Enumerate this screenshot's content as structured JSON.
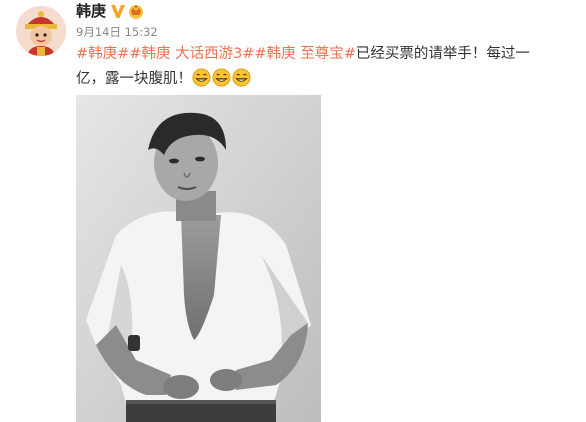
{
  "post": {
    "author": "韩庚",
    "timestamp": "9月14日 15:32",
    "text_segments": [
      {
        "type": "tag",
        "text": "#韩庚#"
      },
      {
        "type": "tag",
        "text": "#韩庚 大话西游3#"
      },
      {
        "type": "tag",
        "text": "#韩庚 至尊宝#"
      },
      {
        "type": "text",
        "text": "已经买票的请举手！每过一亿，露一块腹肌！"
      }
    ],
    "badges": [
      "verified-v-icon",
      "crown-icon"
    ],
    "emojis": [
      "grin-emoji-icon",
      "grin-emoji-icon",
      "grin-emoji-icon"
    ]
  },
  "colors": {
    "tag": "#eb7350",
    "verified": "#f5a623",
    "meta": "#888888"
  }
}
